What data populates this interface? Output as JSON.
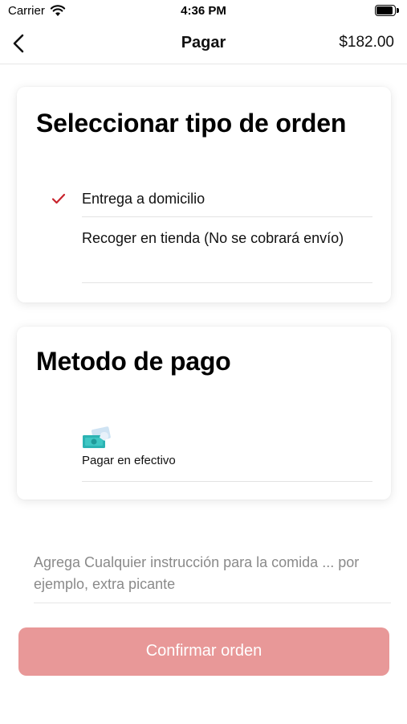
{
  "status_bar": {
    "carrier": "Carrier",
    "time": "4:36 PM",
    "icons": [
      "wifi-icon",
      "battery-icon"
    ]
  },
  "nav": {
    "back_icon": "chevron-left-icon",
    "title": "Pagar",
    "total": "$182.00"
  },
  "order_type": {
    "title": "Seleccionar tipo de orden",
    "options": [
      {
        "label": "Entrega a domicilio",
        "selected": true
      },
      {
        "label": "Recoger en tienda (No se cobrará envío)",
        "selected": false
      }
    ],
    "check_icon": "checkmark-icon",
    "check_color": "#c8232c"
  },
  "payment": {
    "title": "Metodo de pago",
    "methods": [
      {
        "label": "Pagar en efectivo",
        "icon": "cash-icon"
      }
    ]
  },
  "instructions": {
    "placeholder": "Agrega Cualquier instrucción para la comida ... por ejemplo, extra picante"
  },
  "confirm": {
    "label": "Confirmar orden",
    "color": "#e89898"
  }
}
